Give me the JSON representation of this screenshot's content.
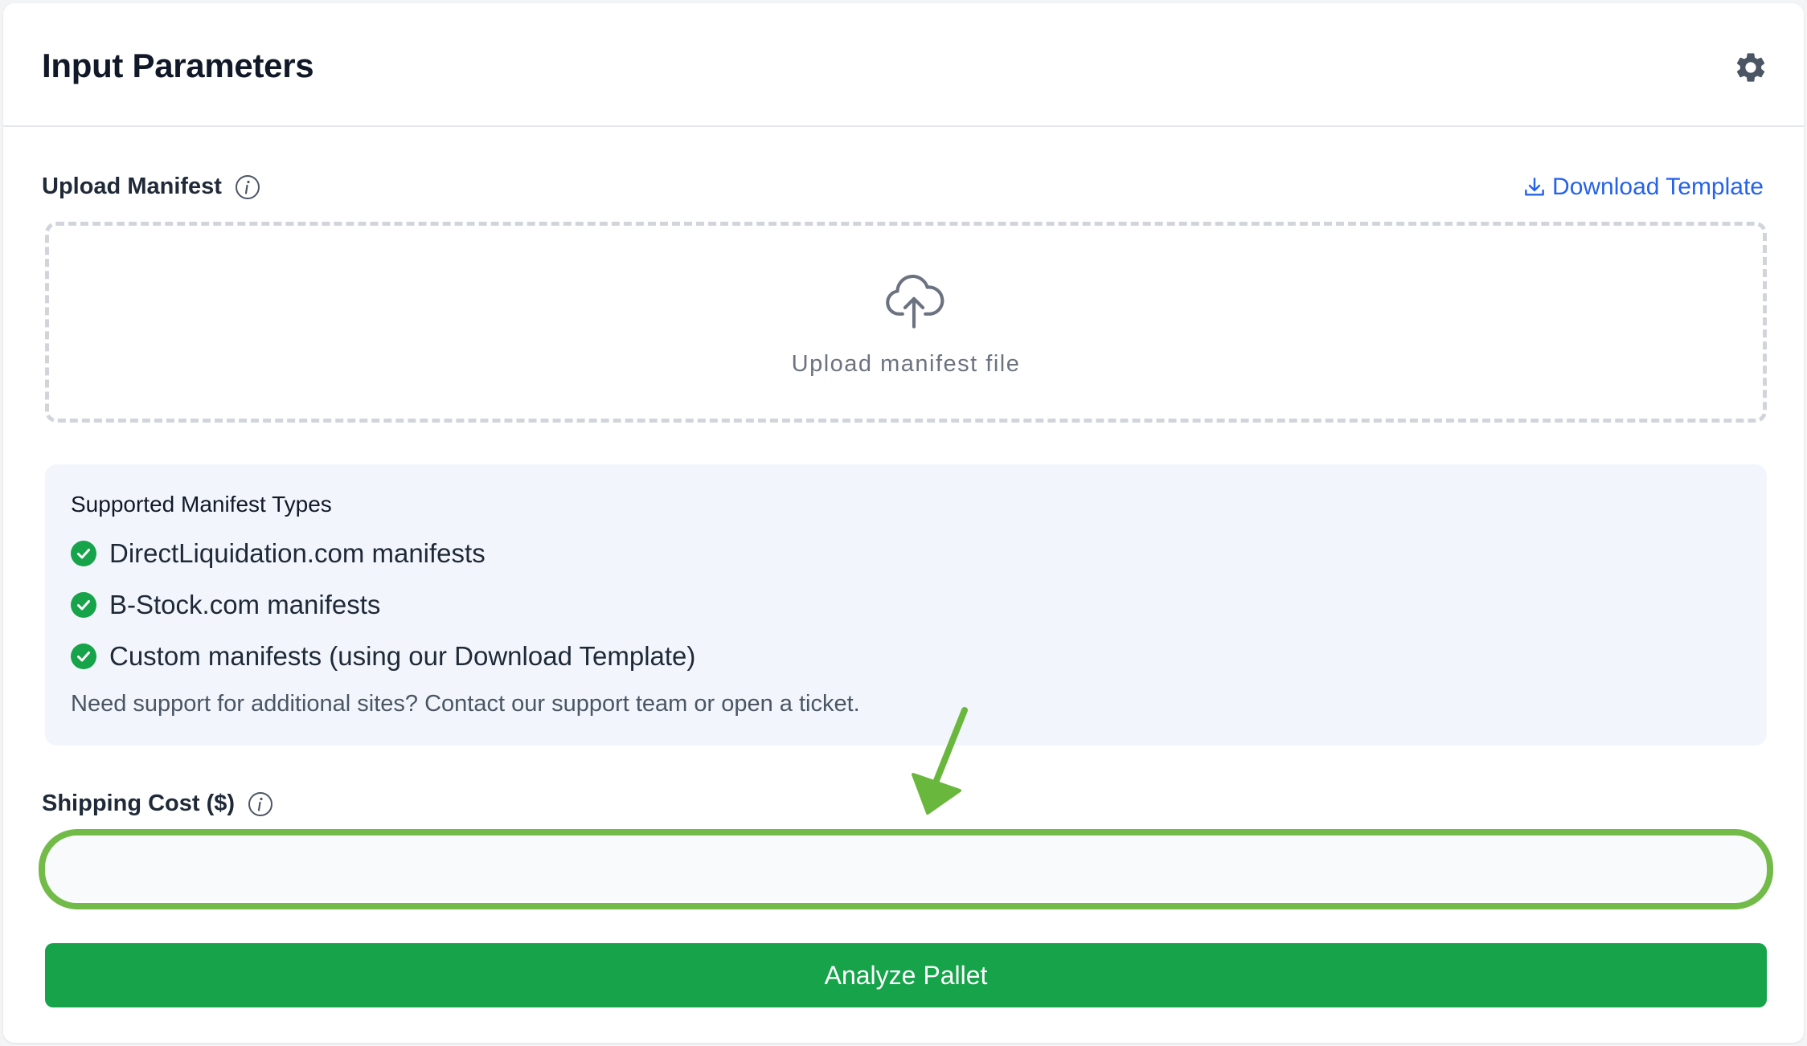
{
  "header": {
    "title": "Input Parameters",
    "settings_icon": "gear-icon"
  },
  "upload": {
    "label": "Upload Manifest",
    "download_template_label": "Download Template",
    "dropzone_text": "Upload manifest file",
    "dropzone_icon": "cloud-upload-icon"
  },
  "supported": {
    "title": "Supported Manifest Types",
    "items": [
      "DirectLiquidation.com manifests",
      "B-Stock.com manifests",
      "Custom manifests (using our Download Template)"
    ],
    "note": "Need support for additional sites? Contact our support team or open a ticket."
  },
  "shipping": {
    "label": "Shipping Cost ($)",
    "value": ""
  },
  "actions": {
    "analyze_label": "Analyze Pallet"
  },
  "colors": {
    "accent_blue": "#2563eb",
    "success_green": "#16a34a",
    "annotation_green": "#6ab73e",
    "panel_bg": "#f2f6fc"
  }
}
